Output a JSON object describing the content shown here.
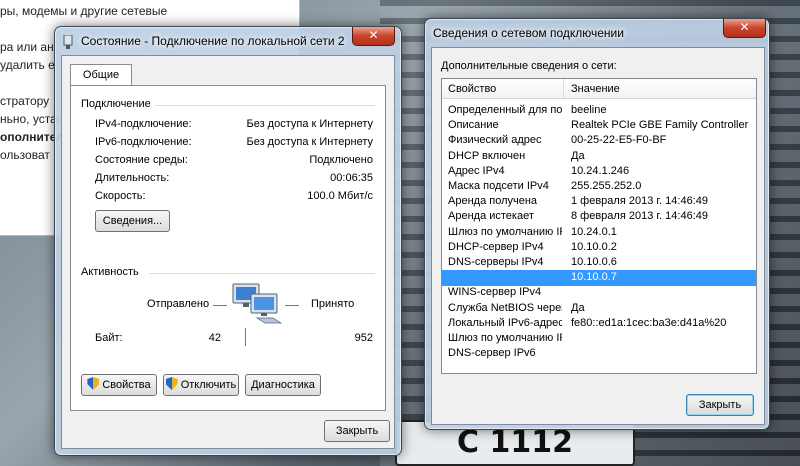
{
  "background_doc": {
    "lines": [
      "ры, модемы и другие сетевые",
      "ра или ан",
      "удалить е",
      "стратору",
      "ньно, устан",
      "ополнител",
      "ользоват"
    ]
  },
  "plate_text": "С 1112",
  "status_window": {
    "title": "Состояние - Подключение по локальной сети 2",
    "close_label": "✕",
    "tab_label": "Общие",
    "connection_heading": "Подключение",
    "rows": [
      {
        "label": "IPv4-подключение:",
        "value": "Без доступа к Интернету"
      },
      {
        "label": "IPv6-подключение:",
        "value": "Без доступа к Интернету"
      },
      {
        "label": "Состояние среды:",
        "value": "Подключено"
      },
      {
        "label": "Длительность:",
        "value": "00:06:35"
      },
      {
        "label": "Скорость:",
        "value": "100.0 Мбит/с"
      }
    ],
    "details_button": "Сведения...",
    "activity_heading": "Активность",
    "sent_label": "Отправлено",
    "received_label": "Принято",
    "bytes_label": "Байт:",
    "bytes_sent": "42",
    "bytes_received": "952",
    "buttons": {
      "properties": "Свойства",
      "disable": "Отключить",
      "diagnose": "Диагностика"
    },
    "close_button": "Закрыть"
  },
  "details_window": {
    "title": "Сведения о сетевом подключении",
    "close_label": "✕",
    "subtitle": "Дополнительные сведения о сети:",
    "columns": {
      "property": "Свойство",
      "value": "Значение"
    },
    "rows": [
      {
        "property": "Определенный для по...",
        "value": "beeline"
      },
      {
        "property": "Описание",
        "value": "Realtek PCIe GBE Family Controller"
      },
      {
        "property": "Физический адрес",
        "value": "00-25-22-E5-F0-BF"
      },
      {
        "property": "DHCP включен",
        "value": "Да"
      },
      {
        "property": "Адрес IPv4",
        "value": "10.24.1.246"
      },
      {
        "property": "Маска подсети IPv4",
        "value": "255.255.252.0"
      },
      {
        "property": "Аренда получена",
        "value": "1 февраля 2013 г. 14:46:49"
      },
      {
        "property": "Аренда истекает",
        "value": "8 февраля 2013 г. 14:46:49"
      },
      {
        "property": "Шлюз по умолчанию IP...",
        "value": "10.24.0.1"
      },
      {
        "property": "DHCP-сервер IPv4",
        "value": "10.10.0.2"
      },
      {
        "property": "DNS-серверы IPv4",
        "value": "10.10.0.6"
      },
      {
        "property": "",
        "value": "10.10.0.7",
        "selected": true
      },
      {
        "property": "WINS-сервер IPv4",
        "value": ""
      },
      {
        "property": "Служба NetBIOS через...",
        "value": "Да"
      },
      {
        "property": "Локальный IPv6-адрес...",
        "value": "fe80::ed1a:1cec:ba3e:d41a%20"
      },
      {
        "property": "Шлюз по умолчанию IP...",
        "value": ""
      },
      {
        "property": "DNS-сервер IPv6",
        "value": ""
      }
    ],
    "close_button": "Закрыть"
  },
  "colors": {
    "selection": "#3399ff",
    "window_frame": "#bed0e4",
    "close_button": "#c8442a"
  }
}
